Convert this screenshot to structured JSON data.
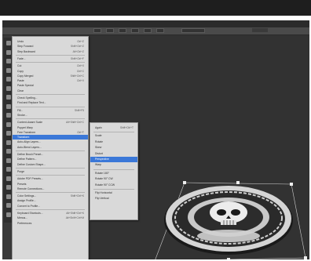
{
  "app": {
    "accent_color": "#3b78d8",
    "menu_bg_color": "#d9d9d9",
    "canvas_color": "#323232"
  },
  "menu": {
    "items": [
      {
        "label": "Undo",
        "shortcut": "Ctrl+Z"
      },
      {
        "label": "Step Forward",
        "shortcut": "Shift+Ctrl+Z"
      },
      {
        "label": "Step Backward",
        "shortcut": "Alt+Ctrl+Z"
      },
      {
        "sep": true
      },
      {
        "label": "Fade...",
        "shortcut": "Shift+Ctrl+F"
      },
      {
        "sep": true
      },
      {
        "label": "Cut",
        "shortcut": "Ctrl+X"
      },
      {
        "label": "Copy",
        "shortcut": "Ctrl+C"
      },
      {
        "label": "Copy Merged",
        "shortcut": "Shift+Ctrl+C"
      },
      {
        "label": "Paste",
        "shortcut": "Ctrl+V"
      },
      {
        "label": "Paste Special",
        "shortcut": ""
      },
      {
        "label": "Clear",
        "shortcut": ""
      },
      {
        "sep": true
      },
      {
        "label": "Check Spelling...",
        "shortcut": ""
      },
      {
        "label": "Find and Replace Text...",
        "shortcut": ""
      },
      {
        "sep": true
      },
      {
        "label": "Fill...",
        "shortcut": "Shift+F5"
      },
      {
        "label": "Stroke...",
        "shortcut": ""
      },
      {
        "sep": true
      },
      {
        "label": "Content-Aware Scale",
        "shortcut": "Alt+Shift+Ctrl+C"
      },
      {
        "label": "Puppet Warp",
        "shortcut": ""
      },
      {
        "label": "Free Transform",
        "shortcut": "Ctrl+T"
      },
      {
        "label": "Transform",
        "shortcut": "",
        "highlight": true
      },
      {
        "label": "Auto-Align Layers...",
        "shortcut": ""
      },
      {
        "label": "Auto-Blend Layers...",
        "shortcut": ""
      },
      {
        "sep": true
      },
      {
        "label": "Define Brush Preset...",
        "shortcut": ""
      },
      {
        "label": "Define Pattern...",
        "shortcut": ""
      },
      {
        "label": "Define Custom Shape...",
        "shortcut": ""
      },
      {
        "sep": true
      },
      {
        "label": "Purge",
        "shortcut": ""
      },
      {
        "sep": true
      },
      {
        "label": "Adobe PDF Presets...",
        "shortcut": ""
      },
      {
        "label": "Presets",
        "shortcut": ""
      },
      {
        "label": "Remote Connections...",
        "shortcut": ""
      },
      {
        "sep": true
      },
      {
        "label": "Color Settings...",
        "shortcut": "Shift+Ctrl+K"
      },
      {
        "label": "Assign Profile...",
        "shortcut": ""
      },
      {
        "label": "Convert to Profile...",
        "shortcut": ""
      },
      {
        "sep": true
      },
      {
        "label": "Keyboard Shortcuts...",
        "shortcut": "Alt+Shift+Ctrl+K"
      },
      {
        "label": "Menus...",
        "shortcut": "Alt+Shift+Ctrl+M"
      },
      {
        "label": "Preferences",
        "shortcut": ""
      }
    ]
  },
  "submenu": {
    "items": [
      {
        "label": "Again",
        "shortcut": "Shift+Ctrl+T"
      },
      {
        "sep": true
      },
      {
        "label": "Scale",
        "shortcut": ""
      },
      {
        "label": "Rotate",
        "shortcut": ""
      },
      {
        "label": "Skew",
        "shortcut": ""
      },
      {
        "label": "Distort",
        "shortcut": ""
      },
      {
        "label": "Perspective",
        "shortcut": "",
        "highlight": true
      },
      {
        "label": "Warp",
        "shortcut": ""
      },
      {
        "sep": true
      },
      {
        "label": "Rotate 180°",
        "shortcut": ""
      },
      {
        "label": "Rotate 90° CW",
        "shortcut": ""
      },
      {
        "label": "Rotate 90° CCW",
        "shortcut": ""
      },
      {
        "sep": true
      },
      {
        "label": "Flip Horizontal",
        "shortcut": ""
      },
      {
        "label": "Flip Vertical",
        "shortcut": ""
      }
    ]
  },
  "icons": {
    "toolbar": [
      "move-icon",
      "marquee-icon",
      "lasso-icon",
      "quick-select-icon",
      "crop-icon",
      "eyedropper-icon",
      "heal-icon",
      "brush-icon",
      "stamp-icon",
      "history-brush-icon",
      "eraser-icon",
      "gradient-icon",
      "blur-icon",
      "dodge-icon",
      "pen-icon",
      "type-icon",
      "path-select-icon",
      "shape-icon",
      "hand-icon",
      "zoom-icon"
    ]
  }
}
